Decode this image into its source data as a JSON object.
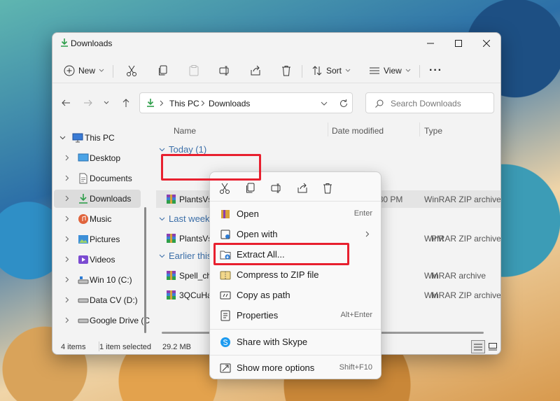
{
  "window": {
    "title": "Downloads"
  },
  "toolbar": {
    "new_label": "New",
    "sort_label": "Sort",
    "view_label": "View",
    "more_label": "···"
  },
  "nav": {
    "breadcrumb": [
      "This PC",
      "Downloads"
    ],
    "search_placeholder": "Search Downloads"
  },
  "sidebar": {
    "items": [
      {
        "label": "This PC",
        "icon": "pc-icon"
      },
      {
        "label": "Desktop",
        "icon": "desktop-icon"
      },
      {
        "label": "Documents",
        "icon": "documents-icon"
      },
      {
        "label": "Downloads",
        "icon": "downloads-icon"
      },
      {
        "label": "Music",
        "icon": "music-icon"
      },
      {
        "label": "Pictures",
        "icon": "pictures-icon"
      },
      {
        "label": "Videos",
        "icon": "videos-icon"
      },
      {
        "label": "Win 10 (C:)",
        "icon": "drive-icon"
      },
      {
        "label": "Data CV (D:)",
        "icon": "drive-icon"
      },
      {
        "label": "Google Drive (C",
        "icon": "drive-icon"
      }
    ]
  },
  "columns": {
    "name": "Name",
    "date": "Date modified",
    "type": "Type"
  },
  "groups": {
    "today": "Today (1)",
    "last_week": "Last week",
    "earlier": "Earlier this"
  },
  "files": [
    {
      "name": "PlantsVsZombies2 (1)",
      "date": "10/3/2021 8:30 PM",
      "type": "WinRAR ZIP archive"
    },
    {
      "name": "PlantsVsZ",
      "date": "PM",
      "type": "WinRAR ZIP archive"
    },
    {
      "name": "Spell_che",
      "date": "M",
      "type": "WinRAR archive"
    },
    {
      "name": "3QCuHar",
      "date": "M",
      "type": "WinRAR ZIP archive"
    }
  ],
  "status": {
    "count": "4 items",
    "selected": "1 item selected",
    "size": "29.2 MB"
  },
  "context_menu": {
    "items": [
      {
        "label": "Open",
        "shortcut": "Enter",
        "icon": "open-icon"
      },
      {
        "label": "Open with",
        "shortcut": "",
        "icon": "open-with-icon"
      },
      {
        "label": "Extract All...",
        "shortcut": "",
        "icon": "extract-icon"
      },
      {
        "label": "Compress to ZIP file",
        "shortcut": "",
        "icon": "zip-icon"
      },
      {
        "label": "Copy as path",
        "shortcut": "",
        "icon": "copy-path-icon"
      },
      {
        "label": "Properties",
        "shortcut": "Alt+Enter",
        "icon": "properties-icon"
      },
      {
        "label": "Share with Skype",
        "shortcut": "",
        "icon": "skype-icon"
      },
      {
        "label": "Show more options",
        "shortcut": "Shift+F10",
        "icon": "more-options-icon"
      }
    ]
  },
  "colors": {
    "accent": "#0067c0",
    "highlight_box": "#e8202f",
    "group_text": "#3b6ea8",
    "download_green": "#2e9e4a"
  }
}
